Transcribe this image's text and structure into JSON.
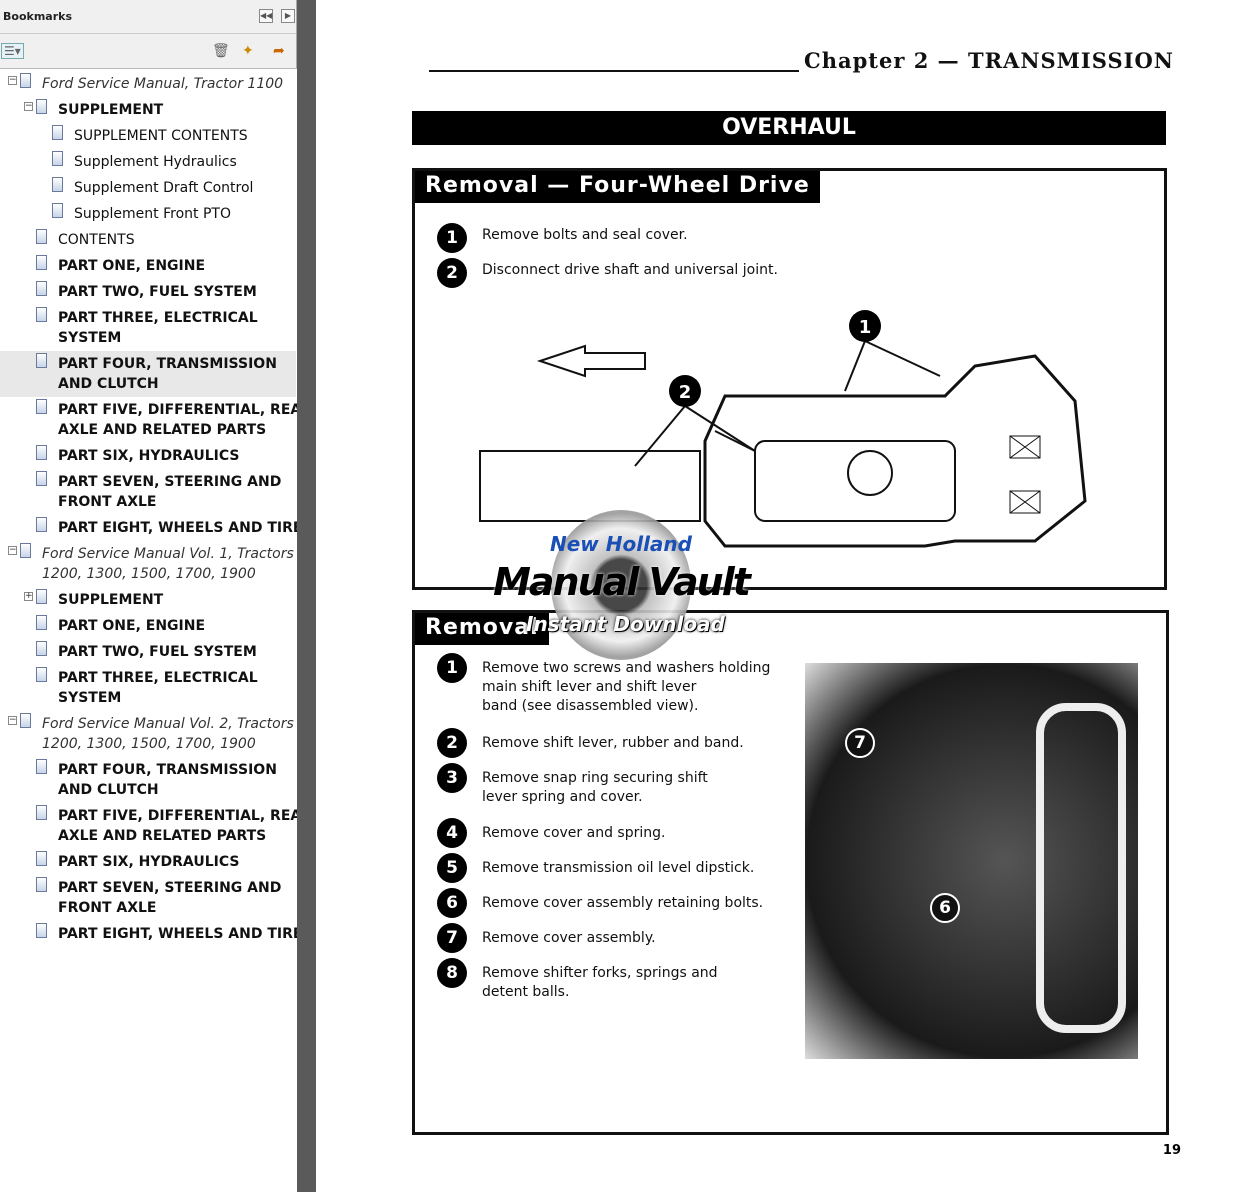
{
  "sidebar": {
    "title": "Bookmarks",
    "icons": [
      "collapse-panel-icon",
      "next-panel-icon",
      "options-menu-icon",
      "delete-bookmark-icon",
      "new-bookmark-icon",
      "expand-bookmark-icon"
    ],
    "items": [
      {
        "label": "Ford Service Manual, Tractor 1100",
        "level": 0,
        "toggle": "-"
      },
      {
        "label": "SUPPLEMENT",
        "level": 1,
        "toggle": "-"
      },
      {
        "label": "SUPPLEMENT CONTENTS",
        "level": 2
      },
      {
        "label": "Supplement Hydraulics",
        "level": 2
      },
      {
        "label": "Supplement Draft Control",
        "level": 2
      },
      {
        "label": "Supplement Front PTO",
        "level": 2
      },
      {
        "label": "CONTENTS",
        "level": 1,
        "normal": true
      },
      {
        "label": "PART ONE, ENGINE",
        "level": 1
      },
      {
        "label": "PART TWO, FUEL SYSTEM",
        "level": 1
      },
      {
        "label": "PART THREE, ELECTRICAL",
        "label2": "SYSTEM",
        "level": 1
      },
      {
        "label": "PART FOUR, TRANSMISSION",
        "label2": "AND CLUTCH",
        "level": 1,
        "selected": true
      },
      {
        "label": "PART FIVE, DIFFERENTIAL, REAR",
        "label2": "AXLE AND RELATED PARTS",
        "level": 1
      },
      {
        "label": "PART SIX, HYDRAULICS",
        "level": 1
      },
      {
        "label": "PART SEVEN, STEERING AND",
        "label2": "FRONT AXLE",
        "level": 1
      },
      {
        "label": "PART EIGHT, WHEELS AND TIRES",
        "level": 1
      },
      {
        "label": "Ford Service Manual Vol. 1, Tractors",
        "label2": "1200, 1300, 1500, 1700, 1900",
        "level": 0,
        "toggle": "-"
      },
      {
        "label": "SUPPLEMENT",
        "level": 1,
        "toggle": "+"
      },
      {
        "label": "PART ONE, ENGINE",
        "level": 1
      },
      {
        "label": "PART TWO, FUEL SYSTEM",
        "level": 1
      },
      {
        "label": "PART THREE, ELECTRICAL",
        "label2": "SYSTEM",
        "level": 1
      },
      {
        "label": "Ford Service Manual Vol. 2, Tractors",
        "label2": "1200, 1300, 1500, 1700, 1900",
        "level": 0,
        "toggle": "-"
      },
      {
        "label": "PART FOUR, TRANSMISSION",
        "label2": "AND CLUTCH",
        "level": 1
      },
      {
        "label": "PART FIVE, DIFFERENTIAL, REAR",
        "label2": "AXLE AND RELATED PARTS",
        "level": 1
      },
      {
        "label": "PART SIX, HYDRAULICS",
        "level": 1
      },
      {
        "label": "PART SEVEN, STEERING AND",
        "label2": "FRONT AXLE",
        "level": 1
      },
      {
        "label": "PART EIGHT, WHEELS AND TIRES",
        "level": 1
      }
    ]
  },
  "page": {
    "chapter": "Chapter 2 — TRANSMISSION",
    "banner": "OVERHAUL",
    "section1": {
      "title": "Removal — Four-Wheel Drive",
      "steps": [
        {
          "n": "1",
          "text": "Remove bolts and seal cover."
        },
        {
          "n": "2",
          "text": "Disconnect drive shaft and universal joint."
        }
      ],
      "callouts": [
        "1",
        "2"
      ]
    },
    "section2": {
      "title": "Removal",
      "steps": [
        {
          "n": "1",
          "lines": [
            "Remove two screws and washers holding",
            "main shift lever and shift lever",
            "band (see disassembled view)."
          ]
        },
        {
          "n": "2",
          "lines": [
            "Remove shift lever, rubber and band."
          ]
        },
        {
          "n": "3",
          "lines": [
            "Remove snap ring securing shift",
            "lever spring and cover."
          ]
        },
        {
          "n": "4",
          "lines": [
            "Remove cover and spring."
          ]
        },
        {
          "n": "5",
          "lines": [
            "Remove transmission oil level dipstick."
          ]
        },
        {
          "n": "6",
          "lines": [
            "Remove cover assembly retaining bolts."
          ]
        },
        {
          "n": "7",
          "lines": [
            "Remove cover assembly."
          ]
        },
        {
          "n": "8",
          "lines": [
            "Remove shifter forks, springs and",
            "detent balls."
          ]
        }
      ],
      "photo_callouts": [
        "7",
        "6"
      ]
    },
    "page_number": "19",
    "watermark": {
      "line1": "New Holland",
      "line2": "Manual Vault",
      "line3": "Instant Download"
    }
  }
}
